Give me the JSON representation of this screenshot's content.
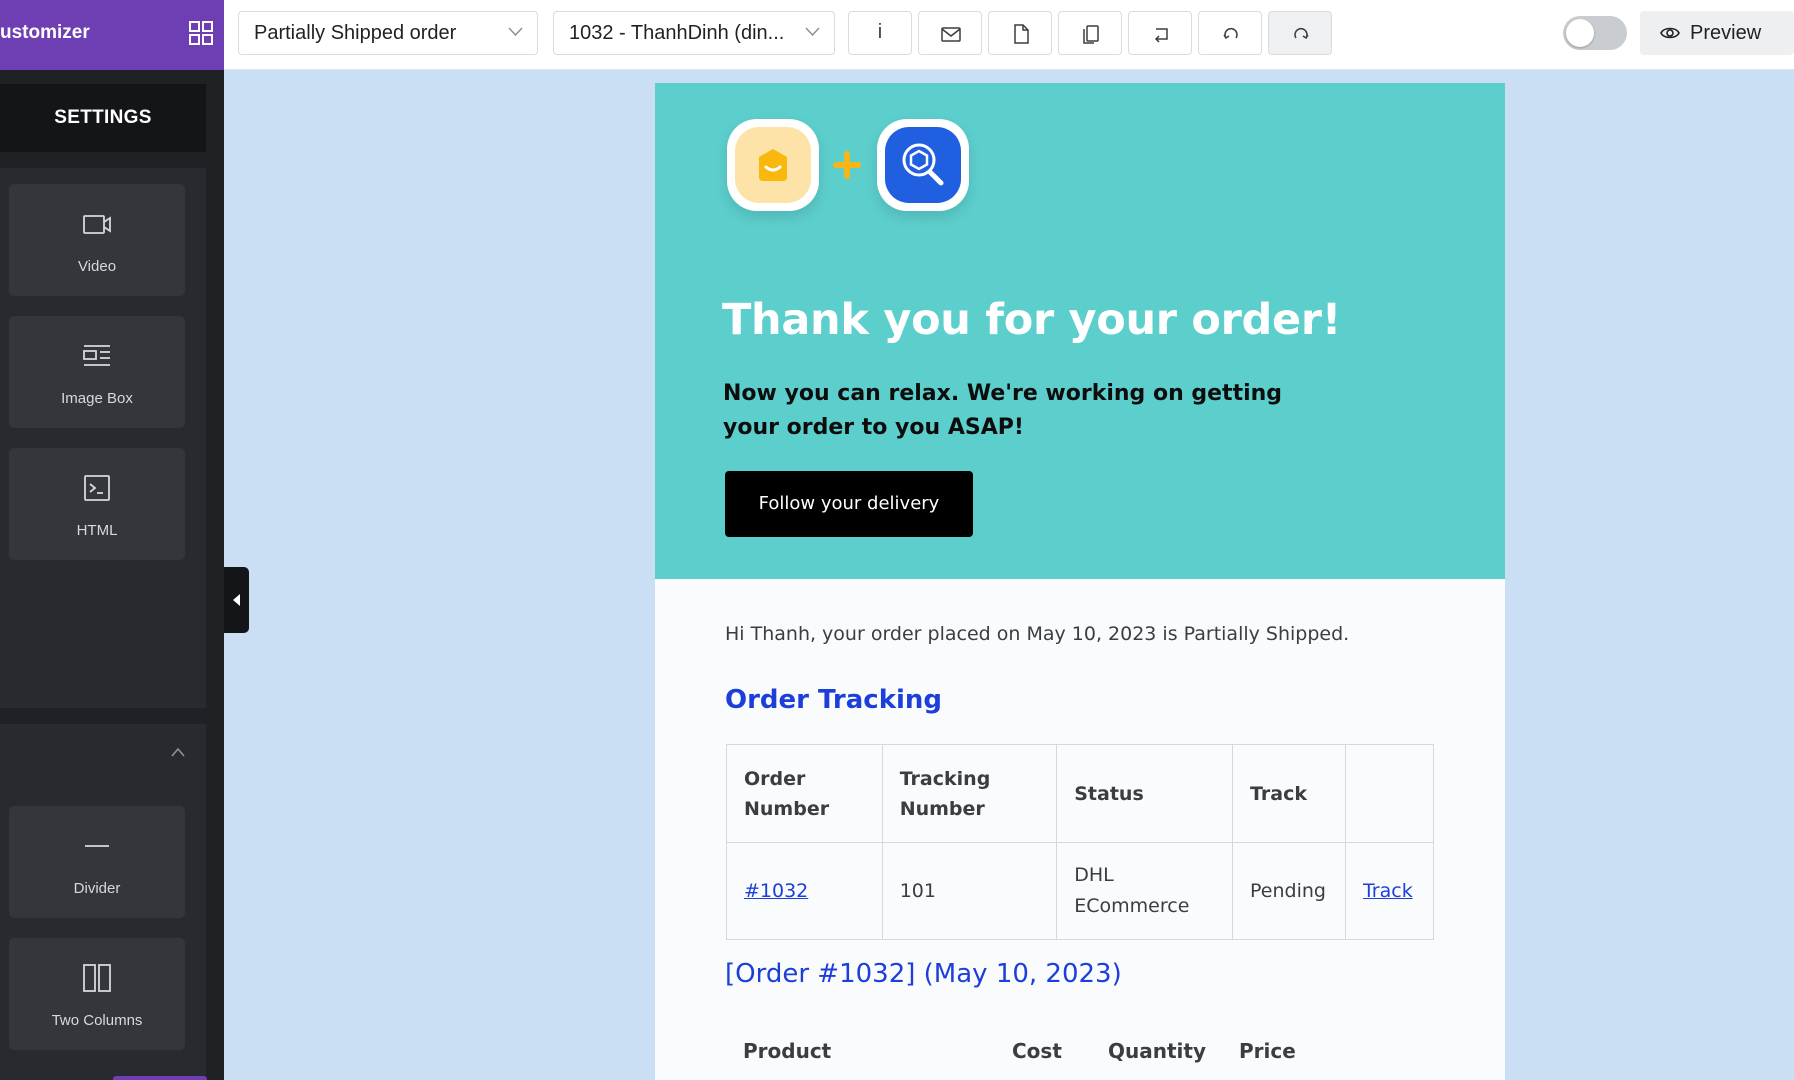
{
  "sidebar": {
    "brand_title": "ustomizer",
    "settings_label": "SETTINGS",
    "tiles": [
      {
        "label": "Video",
        "icon": "video-icon"
      },
      {
        "label": "Image Box",
        "icon": "image-box-icon"
      },
      {
        "label": "HTML",
        "icon": "html-icon"
      },
      {
        "label": "Divider",
        "icon": "divider-icon"
      },
      {
        "label": "Two Columns",
        "icon": "two-columns-icon"
      }
    ]
  },
  "toolbar": {
    "template_select": "Partially Shipped order",
    "order_select": "1032 - ThanhDinh (din...",
    "info_label": "i",
    "preview_label": "Preview"
  },
  "email": {
    "hero_title": "Thank you for your order!",
    "hero_subtitle": "Now you can relax. We're working on getting your order to you ASAP!",
    "cta_label": "Follow your delivery",
    "greeting": "Hi Thanh, your order placed on May 10, 2023 is Partially Shipped.",
    "tracking_title": "Order Tracking",
    "tracking_table": {
      "headers": [
        "Order Number",
        "Tracking Number",
        "Status",
        "Track",
        ""
      ],
      "row": {
        "order_number": "#1032",
        "tracking_number": "101",
        "carrier": "DHL ECommerce",
        "status": "Pending",
        "track_link": "Track"
      }
    },
    "order_title": "[Order #1032] (May 10, 2023)",
    "product_headers": [
      "Product",
      "Cost",
      "Quantity",
      "Price"
    ]
  },
  "colors": {
    "brand_purple": "#6e3fb3",
    "hero_teal": "#5ccfcd",
    "link_blue": "#1b3fd8",
    "canvas_bg": "#cadff4"
  }
}
